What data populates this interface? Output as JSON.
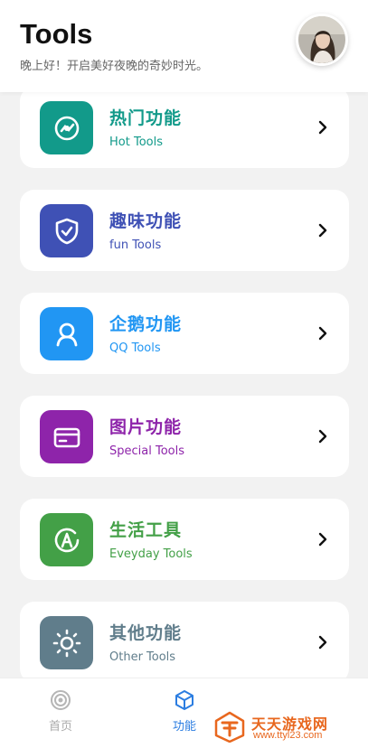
{
  "header": {
    "title": "Tools",
    "greeting": "晚上好！开启美好夜晚的奇妙时光。"
  },
  "cards": [
    {
      "title": "热门功能",
      "subtitle": "Hot Tools",
      "color": "#129a8a",
      "icon": "radar-icon"
    },
    {
      "title": "趣味功能",
      "subtitle": "fun Tools",
      "color": "#3f51b5",
      "icon": "shield-check-icon"
    },
    {
      "title": "企鹅功能",
      "subtitle": "QQ Tools",
      "color": "#2196f3",
      "icon": "person-icon"
    },
    {
      "title": "图片功能",
      "subtitle": "Special Tools",
      "color": "#8e24aa",
      "icon": "card-icon"
    },
    {
      "title": "生活工具",
      "subtitle": "Eveyday Tools",
      "color": "#43a047",
      "icon": "letter-a-icon"
    },
    {
      "title": "其他功能",
      "subtitle": "Other Tools",
      "color": "#607d8b",
      "icon": "sun-icon"
    }
  ],
  "tabbar": {
    "home_label": "首页",
    "func_label": "功能",
    "active_color": "#2b7de1",
    "inactive_color": "#aaaaaa"
  },
  "watermark": {
    "text": "天天游戏网",
    "url": "www.ttyl23.com"
  }
}
